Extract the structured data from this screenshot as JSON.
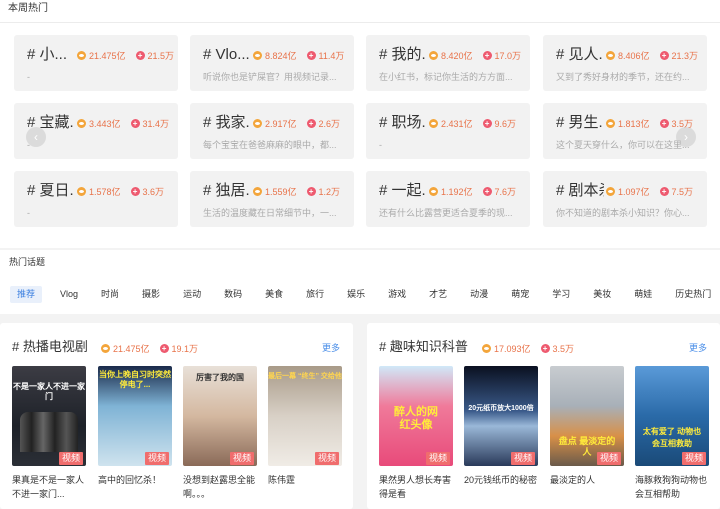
{
  "weekly": {
    "title": "本周热门",
    "cards": [
      {
        "name": "# 小...",
        "views": "21.475亿",
        "adds": "21.5万",
        "desc": "-"
      },
      {
        "name": "# Vlo...",
        "views": "8.824亿",
        "adds": "11.4万",
        "desc": "听说你也是铲屎官？用视频记录..."
      },
      {
        "name": "# 我的...",
        "views": "8.420亿",
        "adds": "17.0万",
        "desc": "在小红书，标记你生活的方方面..."
      },
      {
        "name": "# 见人...",
        "views": "8.406亿",
        "adds": "21.3万",
        "desc": "又到了秀好身材的季节，还在约..."
      },
      {
        "name": "# 宝藏...",
        "views": "3.443亿",
        "adds": "31.4万",
        "desc": "-"
      },
      {
        "name": "# 我家...",
        "views": "2.917亿",
        "adds": "2.6万",
        "desc": "每个宝宝在爸爸麻麻的眼中，都..."
      },
      {
        "name": "# 职场...",
        "views": "2.431亿",
        "adds": "9.6万",
        "desc": "-"
      },
      {
        "name": "# 男生...",
        "views": "1.813亿",
        "adds": "3.5万",
        "desc": "这个夏天穿什么，你可以在这里..."
      },
      {
        "name": "# 夏日...",
        "views": "1.578亿",
        "adds": "3.6万",
        "desc": "-"
      },
      {
        "name": "# 独居...",
        "views": "1.559亿",
        "adds": "1.2万",
        "desc": "生活的温度藏在日常细节中，一..."
      },
      {
        "name": "# 一起...",
        "views": "1.192亿",
        "adds": "7.6万",
        "desc": "还有什么比露营更适合夏季的现..."
      },
      {
        "name": "# 剧本杀",
        "views": "1.097亿",
        "adds": "7.5万",
        "desc": "你不知道的剧本杀小知识？你心..."
      }
    ],
    "prev_arrow": "‹",
    "next_arrow": "›"
  },
  "topics": {
    "title": "热门话题",
    "tabs": [
      "推荐",
      "Vlog",
      "时尚",
      "摄影",
      "运动",
      "数码",
      "美食",
      "旅行",
      "娱乐",
      "游戏",
      "才艺",
      "动漫",
      "萌宠",
      "学习",
      "美妆",
      "萌娃",
      "历史热门"
    ]
  },
  "panels": [
    {
      "title": "# 热播电视剧",
      "views": "21.475亿",
      "adds": "19.1万",
      "more": "更多",
      "videos": [
        {
          "thumb_text": "不是一家人不进一家门",
          "badge": "视频",
          "caption": "果真是不是一家人 不进一家门..."
        },
        {
          "thumb_text": "当你上晚自习时突然停电了...",
          "badge": "视频",
          "caption": "高中的回忆杀！"
        },
        {
          "thumb_text": "厉害了我的国",
          "badge": "视频",
          "caption": "没想到赵露思全能啊。。。"
        },
        {
          "thumb_text": "最后一幕 “终生” 交给他",
          "badge": "视频",
          "caption": "陈伟霆"
        }
      ]
    },
    {
      "title": "# 趣味知识科普",
      "views": "17.093亿",
      "adds": "3.5万",
      "more": "更多",
      "videos": [
        {
          "thumb_text": "醉人的网红头像",
          "badge": "视频",
          "caption": "果然男人想长寿害得是看"
        },
        {
          "thumb_text": "20元纸币放大1000倍",
          "badge": "视频",
          "caption": "20元钱纸币的秘密"
        },
        {
          "thumb_text": "盘点 最淡定的人",
          "badge": "视频",
          "caption": "最淡定的人"
        },
        {
          "thumb_text": "太有爱了 动物也会互相救助",
          "badge": "视频",
          "caption": "海豚救狗狗动物也会互相帮助"
        }
      ]
    }
  ]
}
